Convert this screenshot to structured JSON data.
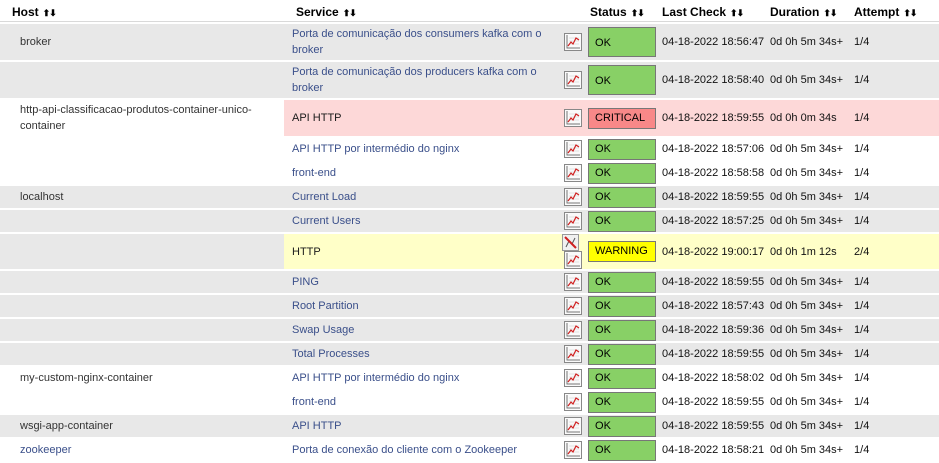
{
  "headers": {
    "host": "Host",
    "service": "Service",
    "status": "Status",
    "last_check": "Last Check",
    "duration": "Duration",
    "attempt": "Attempt"
  },
  "sort_arrows": "⬆⬇",
  "colors": {
    "ok": "#88d066",
    "critical": "#f88888",
    "warning": "#ffff00",
    "link": "#3a4f8a"
  },
  "rows": [
    {
      "host": "broker",
      "service": "Porta de comunicação dos consumers kafka com o broker",
      "status": "OK",
      "last_check": "04-18-2022 18:56:47",
      "duration": "0d 0h 5m 34s+",
      "attempt": "1/4"
    },
    {
      "host": "",
      "service": "Porta de comunicação dos producers kafka com o broker",
      "status": "OK",
      "last_check": "04-18-2022 18:58:40",
      "duration": "0d 0h 5m 34s+",
      "attempt": "1/4"
    },
    {
      "host": "http-api-classificacao-produtos-container-unico-container",
      "service": "API HTTP",
      "status": "CRITICAL",
      "last_check": "04-18-2022 18:59:55",
      "duration": "0d 0h 0m 34s",
      "attempt": "1/4"
    },
    {
      "host": "",
      "service": "API HTTP por intermédio do nginx",
      "status": "OK",
      "last_check": "04-18-2022 18:57:06",
      "duration": "0d 0h 5m 34s+",
      "attempt": "1/4"
    },
    {
      "host": "",
      "service": "front-end",
      "status": "OK",
      "last_check": "04-18-2022 18:58:58",
      "duration": "0d 0h 5m 34s+",
      "attempt": "1/4"
    },
    {
      "host": "localhost",
      "service": "Current Load",
      "status": "OK",
      "last_check": "04-18-2022 18:59:55",
      "duration": "0d 0h 5m 34s+",
      "attempt": "1/4"
    },
    {
      "host": "",
      "service": "Current Users",
      "status": "OK",
      "last_check": "04-18-2022 18:57:25",
      "duration": "0d 0h 5m 34s+",
      "attempt": "1/4"
    },
    {
      "host": "",
      "service": "HTTP",
      "status": "WARNING",
      "last_check": "04-18-2022 19:00:17",
      "duration": "0d 0h 1m 12s",
      "attempt": "2/4"
    },
    {
      "host": "",
      "service": "PING",
      "status": "OK",
      "last_check": "04-18-2022 18:59:55",
      "duration": "0d 0h 5m 34s+",
      "attempt": "1/4"
    },
    {
      "host": "",
      "service": "Root Partition",
      "status": "OK",
      "last_check": "04-18-2022 18:57:43",
      "duration": "0d 0h 5m 34s+",
      "attempt": "1/4"
    },
    {
      "host": "",
      "service": "Swap Usage",
      "status": "OK",
      "last_check": "04-18-2022 18:59:36",
      "duration": "0d 0h 5m 34s+",
      "attempt": "1/4"
    },
    {
      "host": "",
      "service": "Total Processes",
      "status": "OK",
      "last_check": "04-18-2022 18:59:55",
      "duration": "0d 0h 5m 34s+",
      "attempt": "1/4"
    },
    {
      "host": "my-custom-nginx-container",
      "service": "API HTTP por intermédio do nginx",
      "status": "OK",
      "last_check": "04-18-2022 18:58:02",
      "duration": "0d 0h 5m 34s+",
      "attempt": "1/4"
    },
    {
      "host": "",
      "service": "front-end",
      "status": "OK",
      "last_check": "04-18-2022 18:59:55",
      "duration": "0d 0h 5m 34s+",
      "attempt": "1/4"
    },
    {
      "host": "wsgi-app-container",
      "service": "API HTTP",
      "status": "OK",
      "last_check": "04-18-2022 18:59:55",
      "duration": "0d 0h 5m 34s+",
      "attempt": "1/4"
    },
    {
      "host": "zookeeper",
      "service": "Porta de conexão do cliente com o Zookeeper",
      "status": "OK",
      "last_check": "04-18-2022 18:58:21",
      "duration": "0d 0h 5m 34s+",
      "attempt": "1/4"
    }
  ]
}
